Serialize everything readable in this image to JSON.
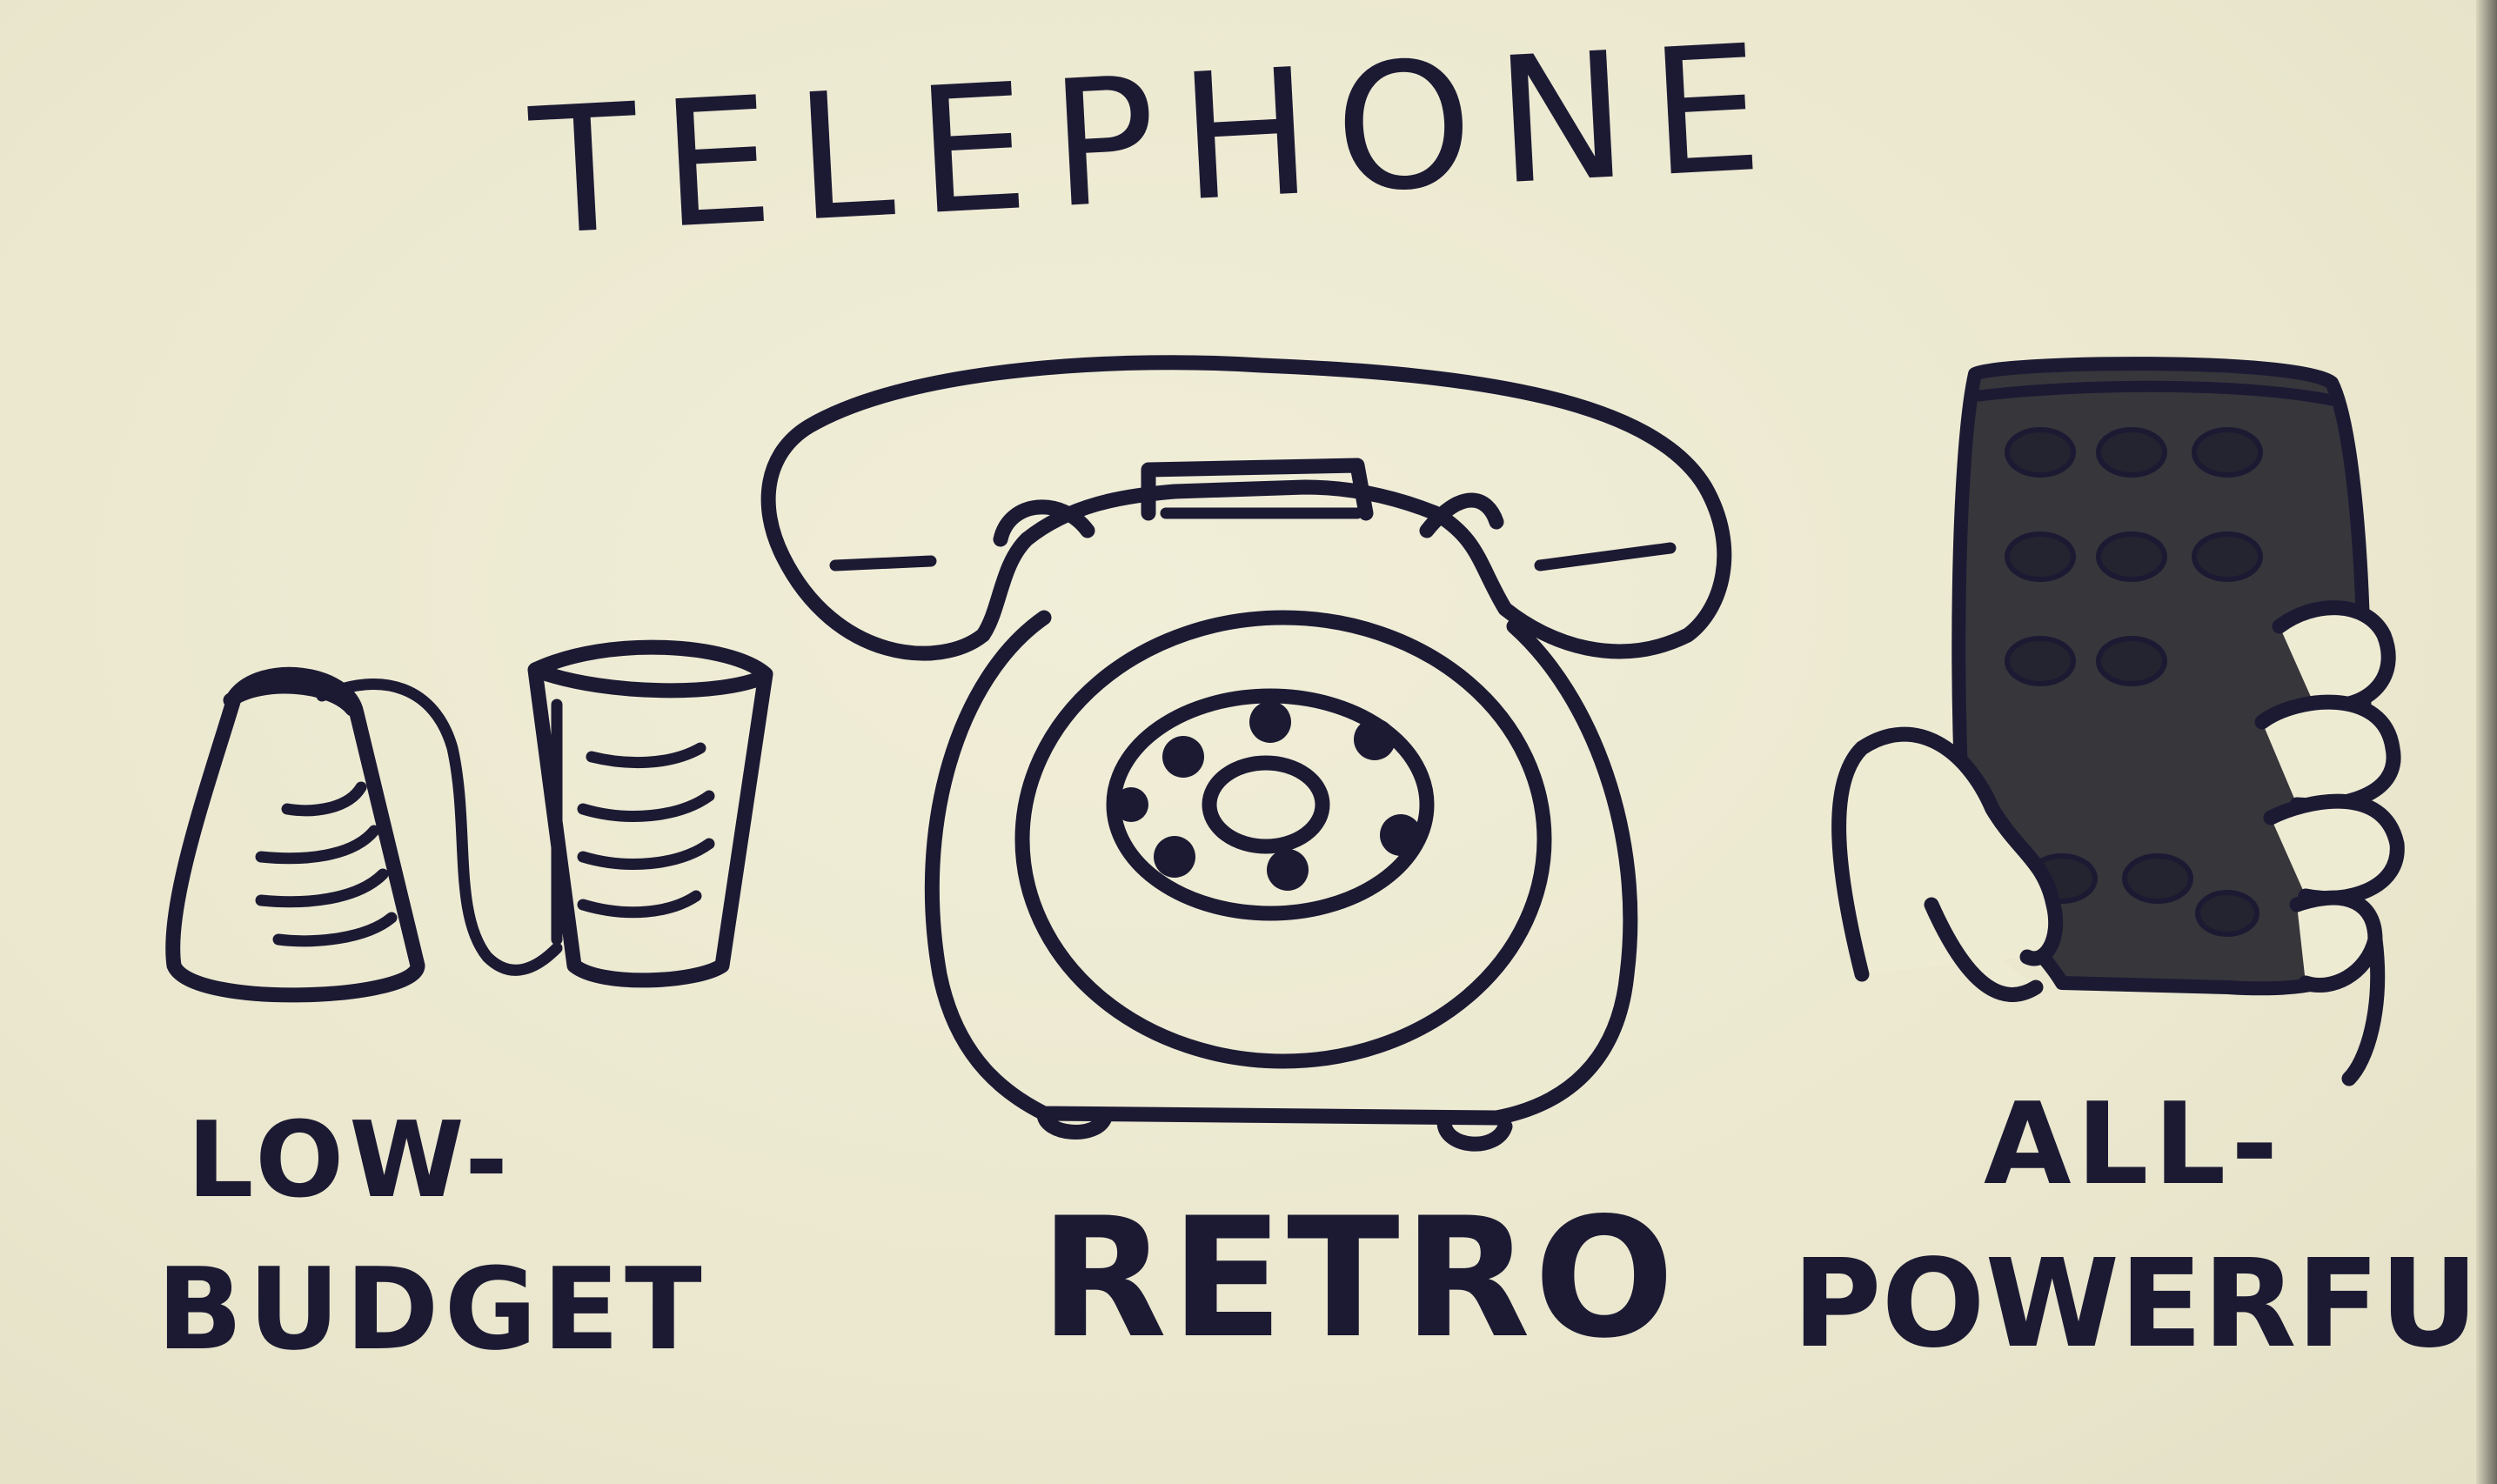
{
  "title": "TELEPHONE",
  "labels": {
    "low_budget_line1": "LOW-",
    "low_budget_line2": "BUDGET",
    "retro": "RETRO",
    "all_powerful_line1": "ALL-",
    "all_powerful_line2": "POWERFUL"
  },
  "colors": {
    "paper": "#eeebd3",
    "ink": "#1c1a33",
    "screen": "#37363b"
  },
  "illustrations": [
    "tin-can-phone-icon",
    "rotary-phone-icon",
    "smartphone-in-hand-icon"
  ]
}
